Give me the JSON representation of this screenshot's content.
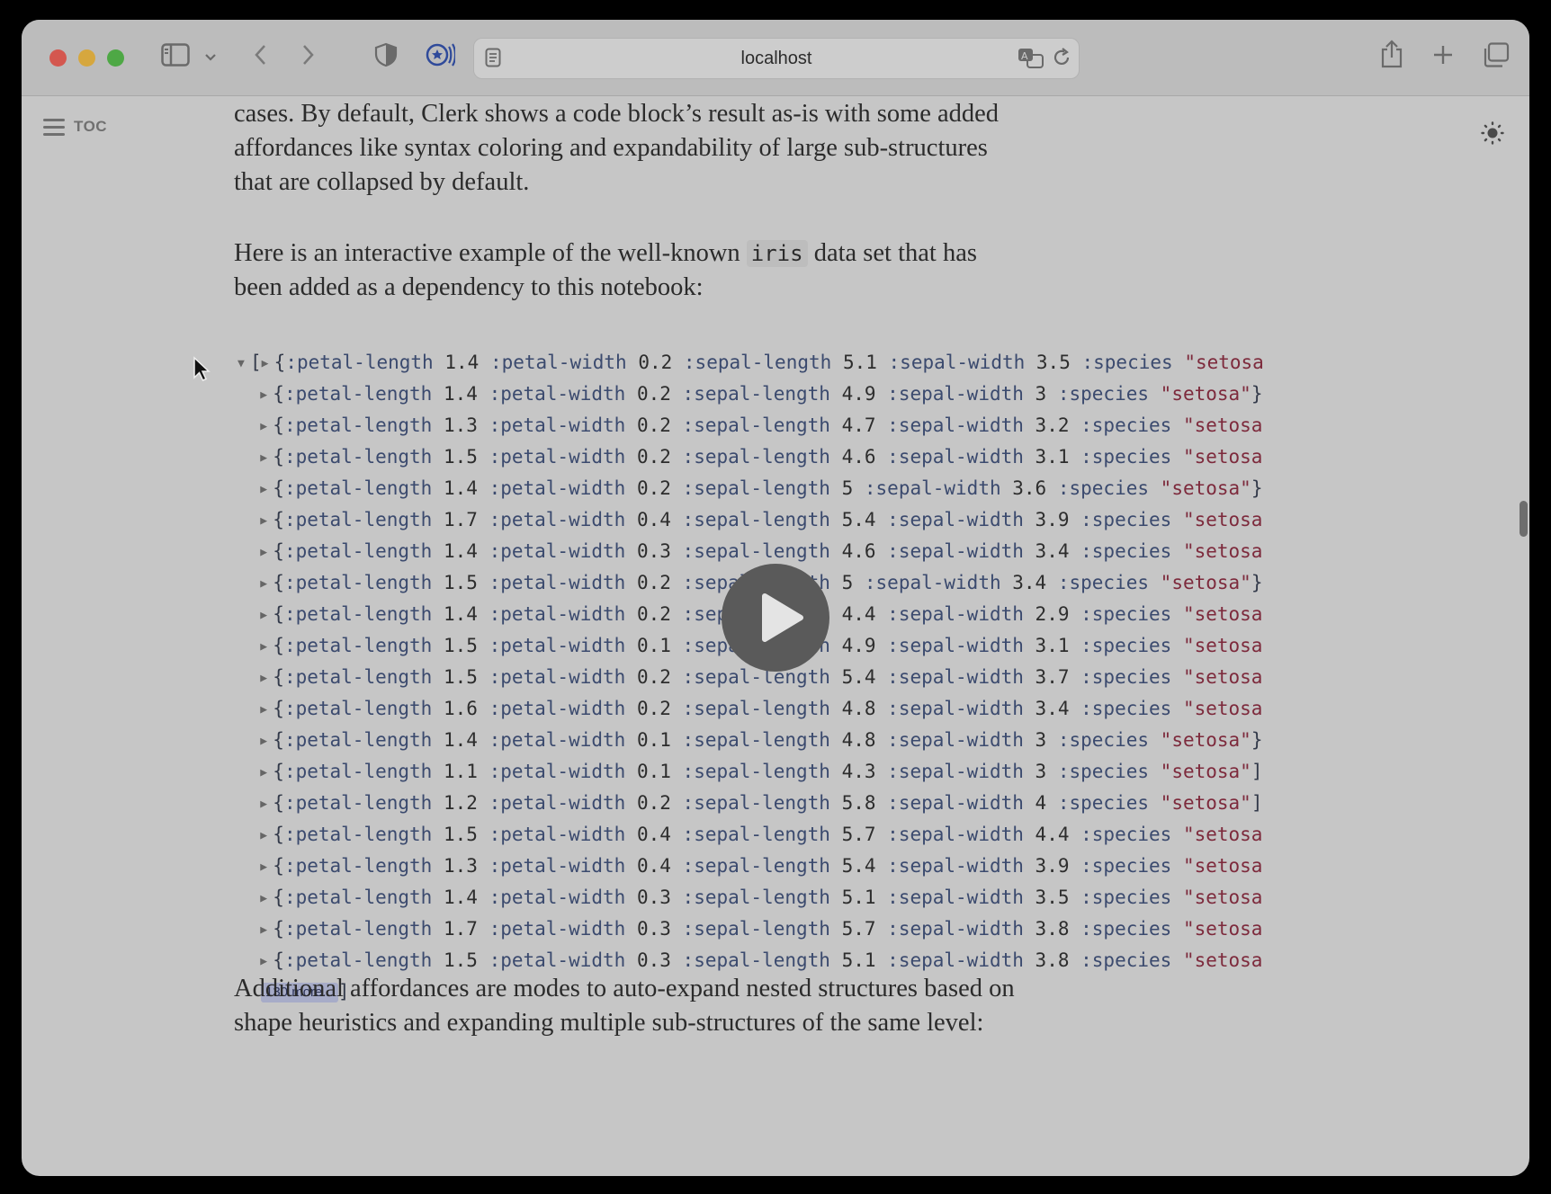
{
  "browser": {
    "url": "localhost",
    "icons": [
      "sidebar-icon",
      "chevron-down-icon",
      "back-icon",
      "forward-icon",
      "shield-icon",
      "extension-icon",
      "reader-icon",
      "translate-icon",
      "reload-icon",
      "share-icon",
      "new-tab-icon",
      "tabs-overview-icon"
    ]
  },
  "sidebar": {
    "toc_label": "TOC"
  },
  "prose": {
    "p1": "Clerk’s built-in viewers try to suit themselves to typical Data Science use cases. By default, Clerk shows a code block’s result as-is with some added affordances like syntax coloring and expandability of large sub-structures that are collapsed by default.",
    "p2_before": "Here is an interactive example of the well-known ",
    "p2_code": "iris",
    "p2_after": " data set that has been added as a dependency to this notebook:",
    "p3": "Additional affordances are modes to auto-expand nested structures based on shape heuristics and expanding multiple sub-structures of the same level:"
  },
  "iris": {
    "keys": {
      "pl": ":petal-length",
      "pw": ":petal-width",
      "sl": ":sepal-length",
      "sw": ":sepal-width",
      "sp": ":species"
    },
    "open_bracket": "[",
    "close_bracket": "]",
    "rows": [
      {
        "pl": "1.4",
        "pw": "0.2",
        "sl": "5.1",
        "sw": "3.5",
        "sp": "\"setosa",
        "end": ""
      },
      {
        "pl": "1.4",
        "pw": "0.2",
        "sl": "4.9",
        "sw": "3",
        "sp": "\"setosa\"",
        "end": "}"
      },
      {
        "pl": "1.3",
        "pw": "0.2",
        "sl": "4.7",
        "sw": "3.2",
        "sp": "\"setosa",
        "end": ""
      },
      {
        "pl": "1.5",
        "pw": "0.2",
        "sl": "4.6",
        "sw": "3.1",
        "sp": "\"setosa",
        "end": ""
      },
      {
        "pl": "1.4",
        "pw": "0.2",
        "sl": "5",
        "sw": "3.6",
        "sp": "\"setosa\"",
        "end": "}"
      },
      {
        "pl": "1.7",
        "pw": "0.4",
        "sl": "5.4",
        "sw": "3.9",
        "sp": "\"setosa",
        "end": ""
      },
      {
        "pl": "1.4",
        "pw": "0.3",
        "sl": "4.6",
        "sw": "3.4",
        "sp": "\"setosa",
        "end": ""
      },
      {
        "pl": "1.5",
        "pw": "0.2",
        "sl": "5",
        "sw": "3.4",
        "sp": "\"setosa\"",
        "end": "}"
      },
      {
        "pl": "1.4",
        "pw": "0.2",
        "sl": "4.4",
        "sw": "2.9",
        "sp": "\"setosa",
        "end": ""
      },
      {
        "pl": "1.5",
        "pw": "0.1",
        "sl": "4.9",
        "sw": "3.1",
        "sp": "\"setosa",
        "end": ""
      },
      {
        "pl": "1.5",
        "pw": "0.2",
        "sl": "5.4",
        "sw": "3.7",
        "sp": "\"setosa",
        "end": ""
      },
      {
        "pl": "1.6",
        "pw": "0.2",
        "sl": "4.8",
        "sw": "3.4",
        "sp": "\"setosa",
        "end": ""
      },
      {
        "pl": "1.4",
        "pw": "0.1",
        "sl": "4.8",
        "sw": "3",
        "sp": "\"setosa\"",
        "end": "}"
      },
      {
        "pl": "1.1",
        "pw": "0.1",
        "sl": "4.3",
        "sw": "3",
        "sp": "\"setosa\"",
        "end": "]"
      },
      {
        "pl": "1.2",
        "pw": "0.2",
        "sl": "5.8",
        "sw": "4",
        "sp": "\"setosa\"",
        "end": "]"
      },
      {
        "pl": "1.5",
        "pw": "0.4",
        "sl": "5.7",
        "sw": "4.4",
        "sp": "\"setosa",
        "end": ""
      },
      {
        "pl": "1.3",
        "pw": "0.4",
        "sl": "5.4",
        "sw": "3.9",
        "sp": "\"setosa",
        "end": ""
      },
      {
        "pl": "1.4",
        "pw": "0.3",
        "sl": "5.1",
        "sw": "3.5",
        "sp": "\"setosa",
        "end": ""
      },
      {
        "pl": "1.7",
        "pw": "0.3",
        "sl": "5.7",
        "sw": "3.8",
        "sp": "\"setosa",
        "end": ""
      },
      {
        "pl": "1.5",
        "pw": "0.3",
        "sl": "5.1",
        "sw": "3.8",
        "sp": "\"setosa",
        "end": ""
      }
    ],
    "more_label": "130 more..."
  },
  "colors": {
    "keyword": "#3b4a6e",
    "string": "#7d2a3c",
    "more_button": "#a7acc8"
  }
}
